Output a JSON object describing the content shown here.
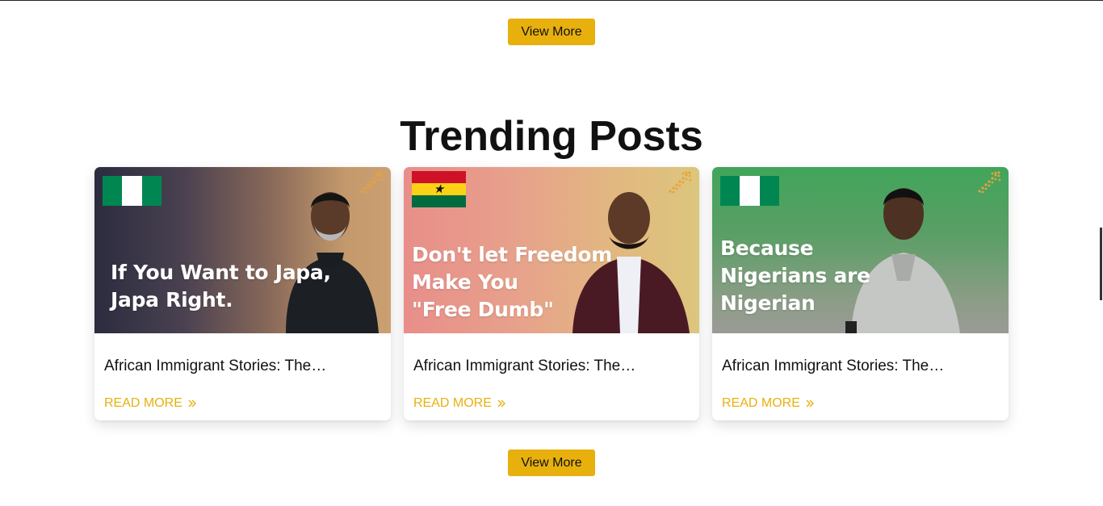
{
  "buttons": {
    "view_more_top": "View More",
    "view_more_bottom": "View More"
  },
  "section": {
    "title": "Trending Posts"
  },
  "posts": [
    {
      "title": "African Immigrant Stories: The…",
      "read_more": "READ MORE",
      "thumbnail_text": "If You Want to Japa,\nJapa Right.",
      "flag": "Nigeria"
    },
    {
      "title": "African Immigrant Stories: The…",
      "read_more": "READ MORE",
      "thumbnail_text": "Don't let Freedom\nMake You\n\"Free Dumb\"",
      "flag": "Ghana"
    },
    {
      "title": "African Immigrant Stories: The…",
      "read_more": "READ MORE",
      "thumbnail_text": "Because\nNigerians are\nNigerian",
      "flag": "Nigeria"
    }
  ],
  "colors": {
    "accent": "#e8b00d",
    "nigeria_green": "#008751",
    "ghana_red": "#ce1126",
    "ghana_gold": "#fcd116",
    "ghana_green": "#006b3f"
  },
  "icons": {
    "read_more": "double-chevron-right-icon",
    "brand": "arrow-logo-icon"
  }
}
